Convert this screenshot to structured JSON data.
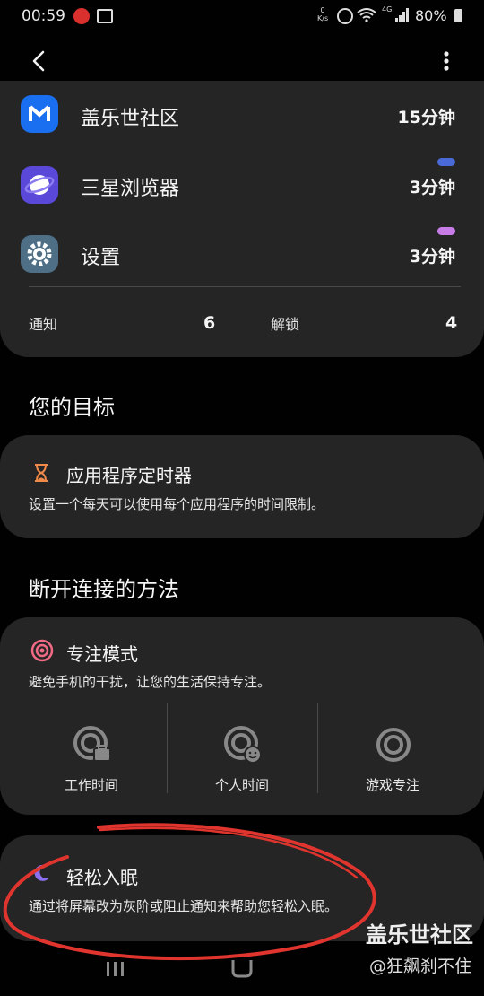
{
  "status_bar": {
    "time": "00:59",
    "net_speed": "0",
    "net_unit": "K/s",
    "network_type": "4G",
    "battery": "80%"
  },
  "usage_list": [
    {
      "name": "盖乐世社区",
      "time": "15分钟",
      "icon": "galaxy-community-icon",
      "color": "#1a6ff0"
    },
    {
      "name": "三星浏览器",
      "time": "3分钟",
      "icon": "samsung-browser-icon",
      "color": "#5a48d8",
      "bar_color": "#4a6ad8"
    },
    {
      "name": "设置",
      "time": "3分钟",
      "icon": "settings-gear-icon",
      "color": "#4f6f86",
      "bar_color": "#c77ce8"
    }
  ],
  "stats": {
    "notifications_label": "通知",
    "notifications_value": "6",
    "unlocks_label": "解锁",
    "unlocks_value": "4"
  },
  "goals": {
    "title": "您的目标",
    "app_timer": {
      "title": "应用程序定时器",
      "description": "设置一个每天可以使用每个应用程序的时间限制。",
      "icon": "hourglass-icon",
      "color": "#f08a4b"
    }
  },
  "disconnect": {
    "title": "断开连接的方法",
    "focus_mode": {
      "title": "专注模式",
      "description": "避免手机的干扰，让您的生活保持专注。",
      "icon": "target-icon",
      "color": "#f06a84",
      "modes": [
        {
          "label": "工作时间",
          "icon": "work-focus-icon"
        },
        {
          "label": "个人时间",
          "icon": "personal-focus-icon"
        },
        {
          "label": "游戏专注",
          "icon": "game-focus-icon"
        }
      ]
    },
    "wind_down": {
      "title": "轻松入眠",
      "description": "通过将屏幕改为灰阶或阻止通知来帮助您轻松入眠。",
      "icon": "moon-icon"
    }
  },
  "watermark": {
    "line1": "盖乐世社区",
    "line2": "@狂飙刹不住"
  },
  "colors": {
    "background": "#010101",
    "card": "#252525",
    "annotation_red": "#e0342e"
  }
}
